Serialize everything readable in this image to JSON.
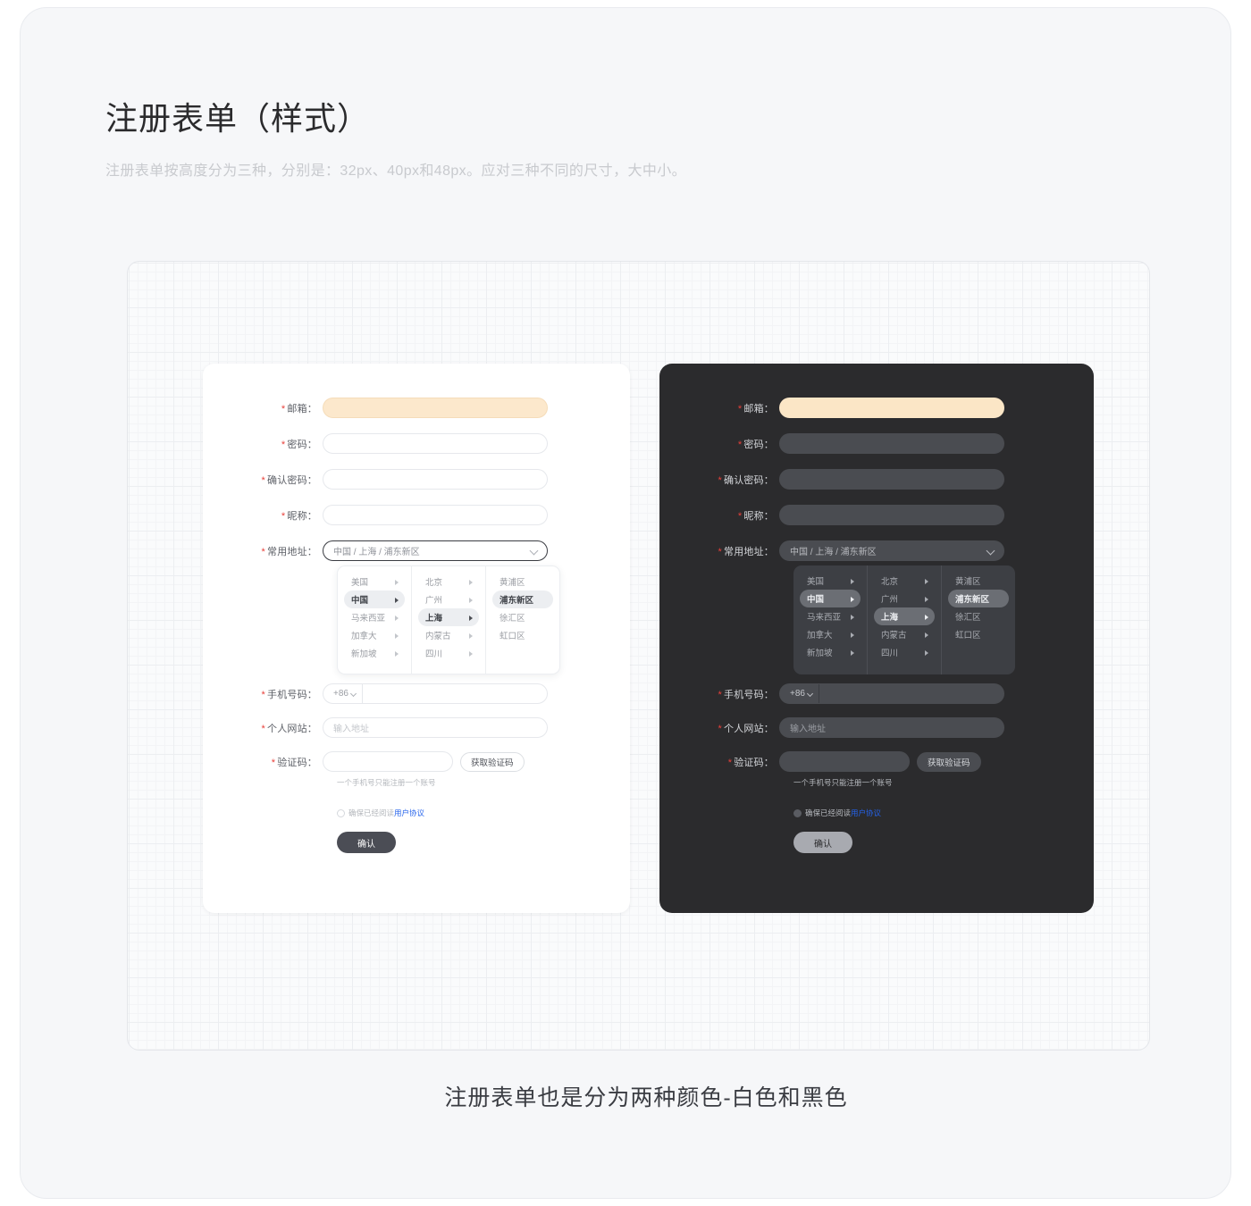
{
  "header": {
    "title": "注册表单（样式）",
    "subtitle": "注册表单按高度分为三种，分别是：32px、40px和48px。应对三种不同的尺寸，大中小。"
  },
  "caption": "注册表单也是分为两种颜色-白色和黑色",
  "colors": {
    "page_bg": "#f6f7f9",
    "panel_light_bg": "#ffffff",
    "panel_dark_bg": "#2b2b2d",
    "email_fill": "#fce8cc",
    "required_star": "#e8403a",
    "link": "#2563eb",
    "primary_light": "#4b4d55",
    "primary_dark": "#a8aab0",
    "cascader_dark_bg": "#3d3f44",
    "cascader_dark_sel": "#6b6e74"
  },
  "form": {
    "labels": {
      "email": "邮箱：",
      "password": "密码：",
      "confirm_password": "确认密码：",
      "nickname": "昵称：",
      "address": "常用地址：",
      "phone": "手机号码：",
      "website": "个人网站：",
      "captcha": "验证码："
    },
    "star": "*",
    "values": {
      "email": "",
      "password": "",
      "confirm_password": "",
      "nickname": "",
      "address": "中国 / 上海 / 浦东新区",
      "phone_prefix": "+86",
      "phone": "",
      "captcha": ""
    },
    "placeholders": {
      "website": "输入地址"
    },
    "hint": "一个手机号只能注册一个账号",
    "captcha_button": "获取验证码",
    "agreement_prefix": "确保已经阅读",
    "agreement_link": "用户协议",
    "submit": "确认"
  },
  "cascader": {
    "columns": [
      {
        "items": [
          {
            "label": "美国",
            "selected": false,
            "has_children": true
          },
          {
            "label": "中国",
            "selected": true,
            "has_children": true
          },
          {
            "label": "马来西亚",
            "selected": false,
            "has_children": true
          },
          {
            "label": "加拿大",
            "selected": false,
            "has_children": true
          },
          {
            "label": "新加坡",
            "selected": false,
            "has_children": true
          }
        ]
      },
      {
        "items": [
          {
            "label": "北京",
            "selected": false,
            "has_children": true
          },
          {
            "label": "广州",
            "selected": false,
            "has_children": true
          },
          {
            "label": "上海",
            "selected": true,
            "has_children": true
          },
          {
            "label": "内蒙古",
            "selected": false,
            "has_children": true
          },
          {
            "label": "四川",
            "selected": false,
            "has_children": true
          }
        ]
      },
      {
        "items": [
          {
            "label": "黄浦区",
            "selected": false,
            "has_children": false
          },
          {
            "label": "浦东新区",
            "selected": true,
            "has_children": false
          },
          {
            "label": "徐汇区",
            "selected": false,
            "has_children": false
          },
          {
            "label": "虹口区",
            "selected": false,
            "has_children": false
          }
        ]
      }
    ]
  }
}
